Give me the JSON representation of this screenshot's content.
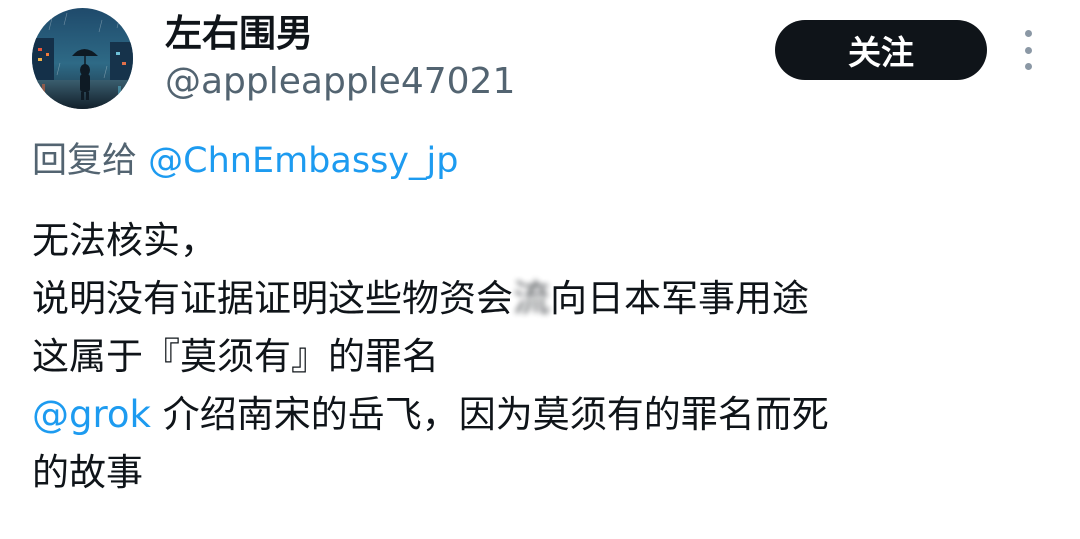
{
  "author": {
    "display_name": "左右围男",
    "handle": "@appleapple47021",
    "avatar_icon": "avatar-rainy-street-umbrella"
  },
  "header": {
    "follow_label": "关注",
    "more_icon": "more-vertical-icon"
  },
  "reply": {
    "prefix": "回复给",
    "to_handle": "@ChnEmbassy_jp"
  },
  "tweet": {
    "line1": "无法核实，",
    "line2_before": "说明没有证据证明这些物资会",
    "line2_blurred": "流",
    "line2_after": "向日本军事用途",
    "line3": "这属于『莫须有』的罪名",
    "line4_mention": "@grok",
    "line4_text": "介绍南宋的岳飞，因为莫须有的罪名而死",
    "line5": "的故事"
  },
  "colors": {
    "text": "#0f1419",
    "secondary": "#536471",
    "link": "#1d9bf0",
    "button_bg": "#0f1419",
    "button_text": "#ffffff"
  }
}
